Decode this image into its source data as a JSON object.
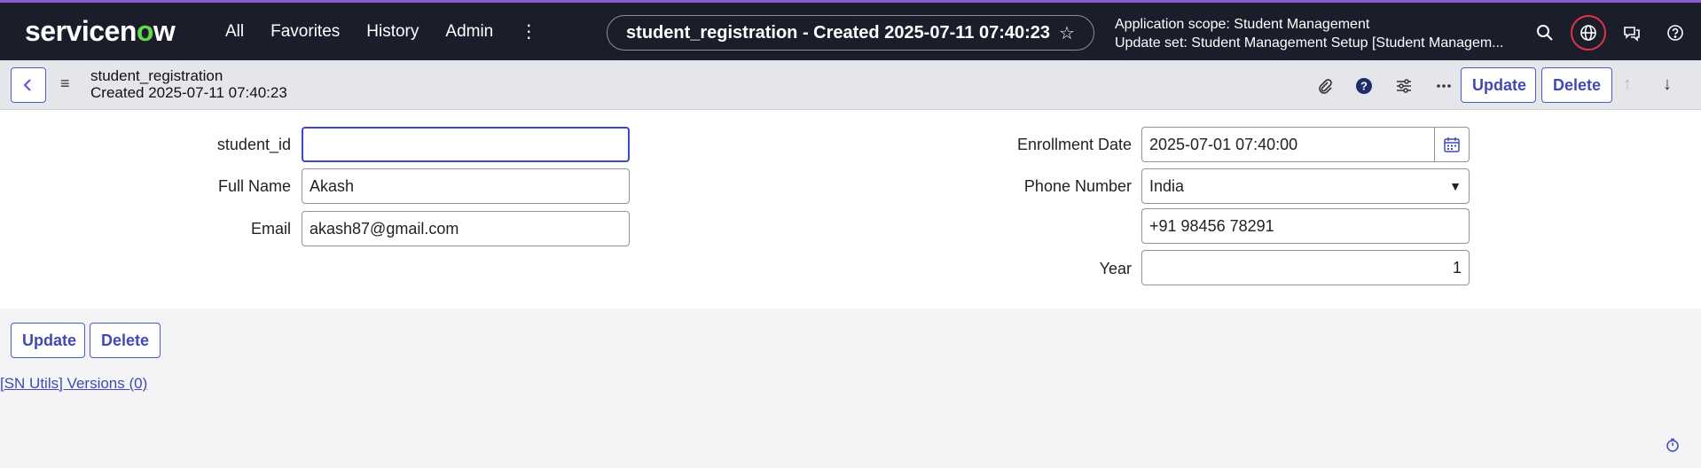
{
  "brand": {
    "name_prefix": "servicen",
    "name_o": "o",
    "name_suffix": "w"
  },
  "nav": {
    "items": [
      "All",
      "Favorites",
      "History",
      "Admin"
    ],
    "more_icon": "kebab-vertical-icon"
  },
  "header": {
    "title": "student_registration - Created 2025-07-11 07:40:23",
    "scope_line": "Application scope: Student Management",
    "update_set_line": "Update set: Student Management Setup [Student Managem..."
  },
  "form_header": {
    "table": "student_registration",
    "created": "Created 2025-07-11 07:40:23",
    "update_label": "Update",
    "delete_label": "Delete"
  },
  "form": {
    "student_id": {
      "label": "student_id",
      "value": ""
    },
    "full_name": {
      "label": "Full Name",
      "value": "Akash"
    },
    "email": {
      "label": "Email",
      "value": "akash87@gmail.com"
    },
    "enrollment_date": {
      "label": "Enrollment Date",
      "value": "2025-07-01 07:40:00"
    },
    "phone": {
      "label": "Phone Number",
      "country": "India",
      "value": "+91 98456 78291"
    },
    "year": {
      "label": "Year",
      "value": "1"
    }
  },
  "footer": {
    "update_label": "Update",
    "delete_label": "Delete",
    "versions_link": "[SN Utils] Versions (0)"
  },
  "colors": {
    "topbar": "#1b1d2a",
    "accent": "#4b5ad3",
    "logo_o": "#62d84e",
    "globe_ring": "#e0324b"
  }
}
